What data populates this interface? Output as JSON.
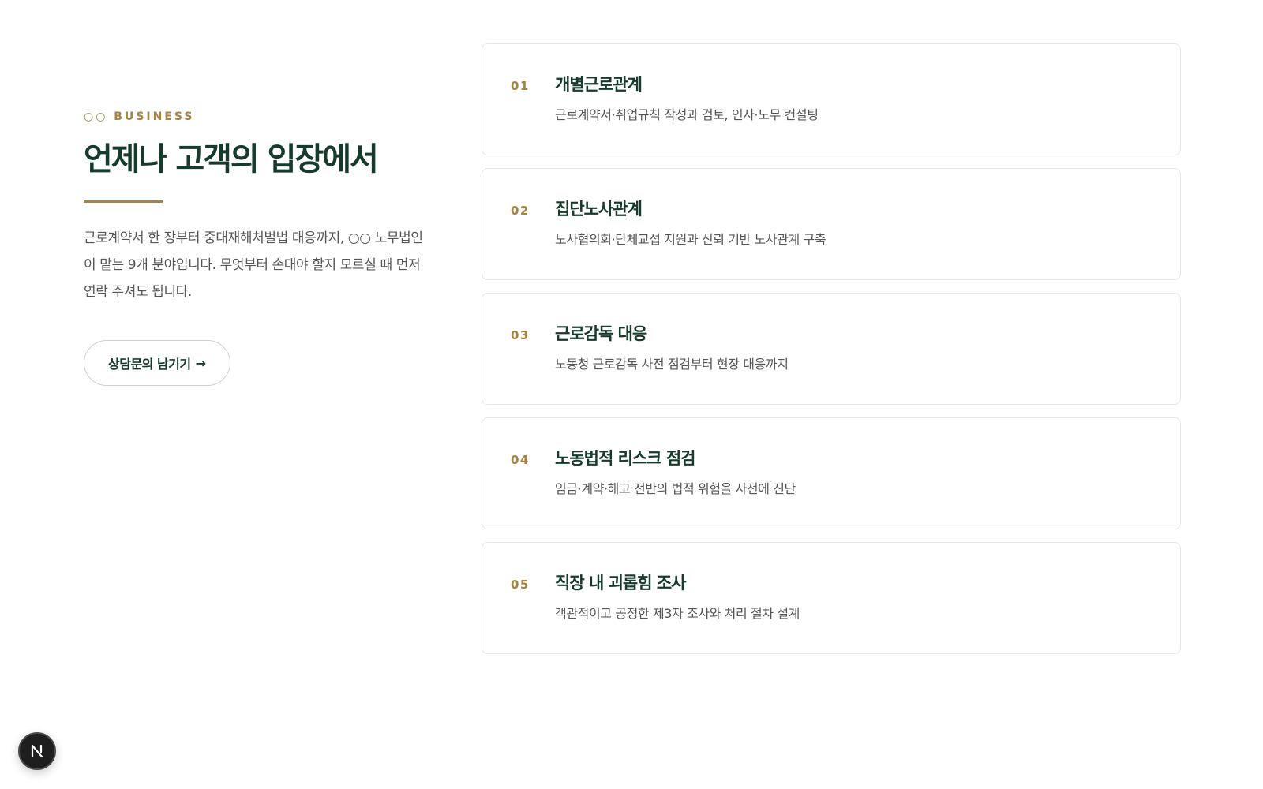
{
  "hero": {
    "eyebrow": "○○ BUSINESS",
    "headline": "언제나 고객의 입장에서",
    "intro": "근로계약서 한 장부터 중대재해처벌법 대응까지, ○○ 노무법인이 맡는 9개 분야입니다. 무엇부터 손대야 할지 모르실 때 먼저 연락 주셔도 됩니다.",
    "cta_label": "상담문의 남기기",
    "cta_arrow": "→"
  },
  "services": [
    {
      "number": "01",
      "title": "개별근로관계",
      "description": "근로계약서·취업규칙 작성과 검토, 인사·노무 컨설팅"
    },
    {
      "number": "02",
      "title": "집단노사관계",
      "description": "노사협의회·단체교섭 지원과 신뢰 기반 노사관계 구축"
    },
    {
      "number": "03",
      "title": "근로감독 대응",
      "description": "노동청 근로감독 사전 점검부터 현장 대응까지"
    },
    {
      "number": "04",
      "title": "노동법적 리스크 점검",
      "description": "임금·계약·해고 전반의 법적 위험을 사전에 진단"
    },
    {
      "number": "05",
      "title": "직장 내 괴롭힘 조사",
      "description": "객관적이고 공정한 제3자 조사와 처리 절차 설계"
    }
  ],
  "badge": {
    "icon": "nextjs-logo-icon",
    "letter": "N"
  },
  "colors": {
    "primary": "#163a2b",
    "accent": "#a8823f",
    "body_text": "#555555",
    "card_border": "#e5e8e6"
  }
}
